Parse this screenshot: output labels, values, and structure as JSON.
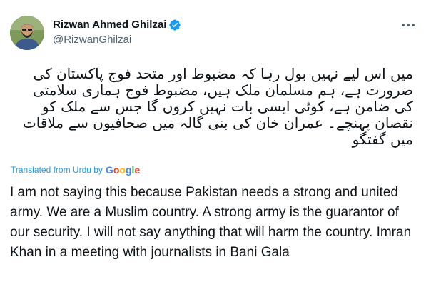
{
  "tweet": {
    "author": {
      "display_name": "Rizwan Ahmed Ghilzai",
      "handle": "@RizwanGhilzai",
      "verified": true
    },
    "original_text": "میں اس لیے نہیں بول رہا کہ مضبوط اور متحد فوج پاکستان کی ضرورت ہے، ہم مسلمان ملک ہیں، مضبوط فوج ہماری سلامتی کی ضامن ہے، کوئی ایسی بات نہیں کروں گا جس سے ملک کو نقصان پہنچے۔ عمران خان کی بنی گالہ میں صحافیوں سے ملاقات میں گفتگو",
    "translation_label": "Translated from Urdu by",
    "translation_provider": {
      "letters": [
        "G",
        "o",
        "o",
        "g",
        "l",
        "e"
      ],
      "colors": [
        "#4285f4",
        "#ea4335",
        "#fbbc05",
        "#4285f4",
        "#34a853",
        "#ea4335"
      ]
    },
    "translated_text": "I am not saying this because Pakistan needs a strong and united army. We are a Muslim country. A strong army is the guarantor of our security. I will not say anything that will harm the country. Imran Khan in a meeting with journalists in Bani Gala"
  },
  "icons": {
    "verified": "verified-badge-icon",
    "more": "more-options-icon"
  },
  "colors": {
    "text_primary": "#0f1419",
    "text_secondary": "#536471",
    "accent": "#1d9bf0"
  }
}
